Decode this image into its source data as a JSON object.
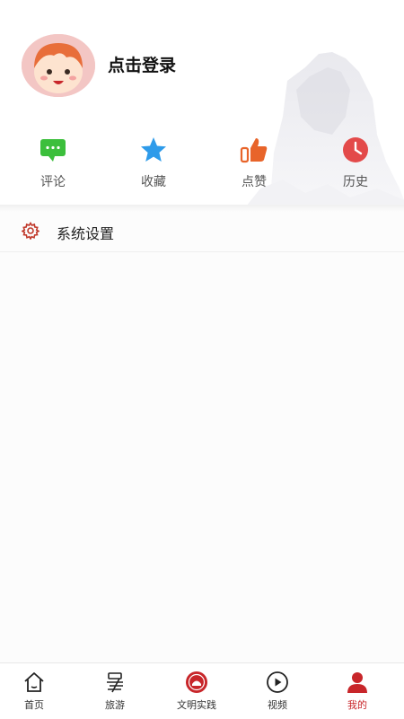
{
  "profile": {
    "login_prompt": "点击登录"
  },
  "shortcuts": [
    {
      "label": "评论",
      "icon": "comment-icon",
      "color": "#3cbf3c"
    },
    {
      "label": "收藏",
      "icon": "star-icon",
      "color": "#2e9bea"
    },
    {
      "label": "点赞",
      "icon": "thumbs-up-icon",
      "color": "#e8642a"
    },
    {
      "label": "历史",
      "icon": "clock-icon",
      "color": "#e34a4a"
    }
  ],
  "settings": {
    "label": "系统设置",
    "icon": "gear-icon",
    "color": "#c0392b"
  },
  "tabbar": {
    "active_color": "#c8262a",
    "items": [
      {
        "label": "首页",
        "icon": "home-icon"
      },
      {
        "label": "旅游",
        "icon": "travel-icon"
      },
      {
        "label": "文明实践",
        "icon": "civilization-badge-icon"
      },
      {
        "label": "视频",
        "icon": "play-icon"
      },
      {
        "label": "我的",
        "icon": "person-icon",
        "active": true
      }
    ]
  }
}
